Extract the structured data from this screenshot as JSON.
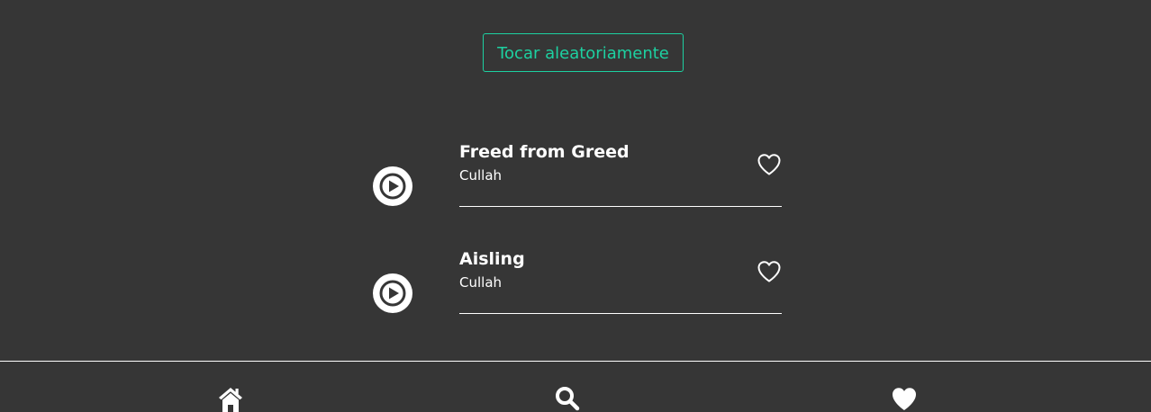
{
  "shuffle": {
    "label": "Tocar aleatoriamente",
    "accent_color": "#1dd1a1"
  },
  "tracks": [
    {
      "title": "Freed from Greed",
      "artist": "Cullah",
      "favorited": false
    },
    {
      "title": "Aisling",
      "artist": "Cullah",
      "favorited": false
    }
  ],
  "bottom_nav": {
    "items": [
      {
        "icon": "home-icon"
      },
      {
        "icon": "search-icon"
      },
      {
        "icon": "heart-icon"
      }
    ]
  },
  "colors": {
    "background": "#363636",
    "foreground": "#ffffff"
  }
}
